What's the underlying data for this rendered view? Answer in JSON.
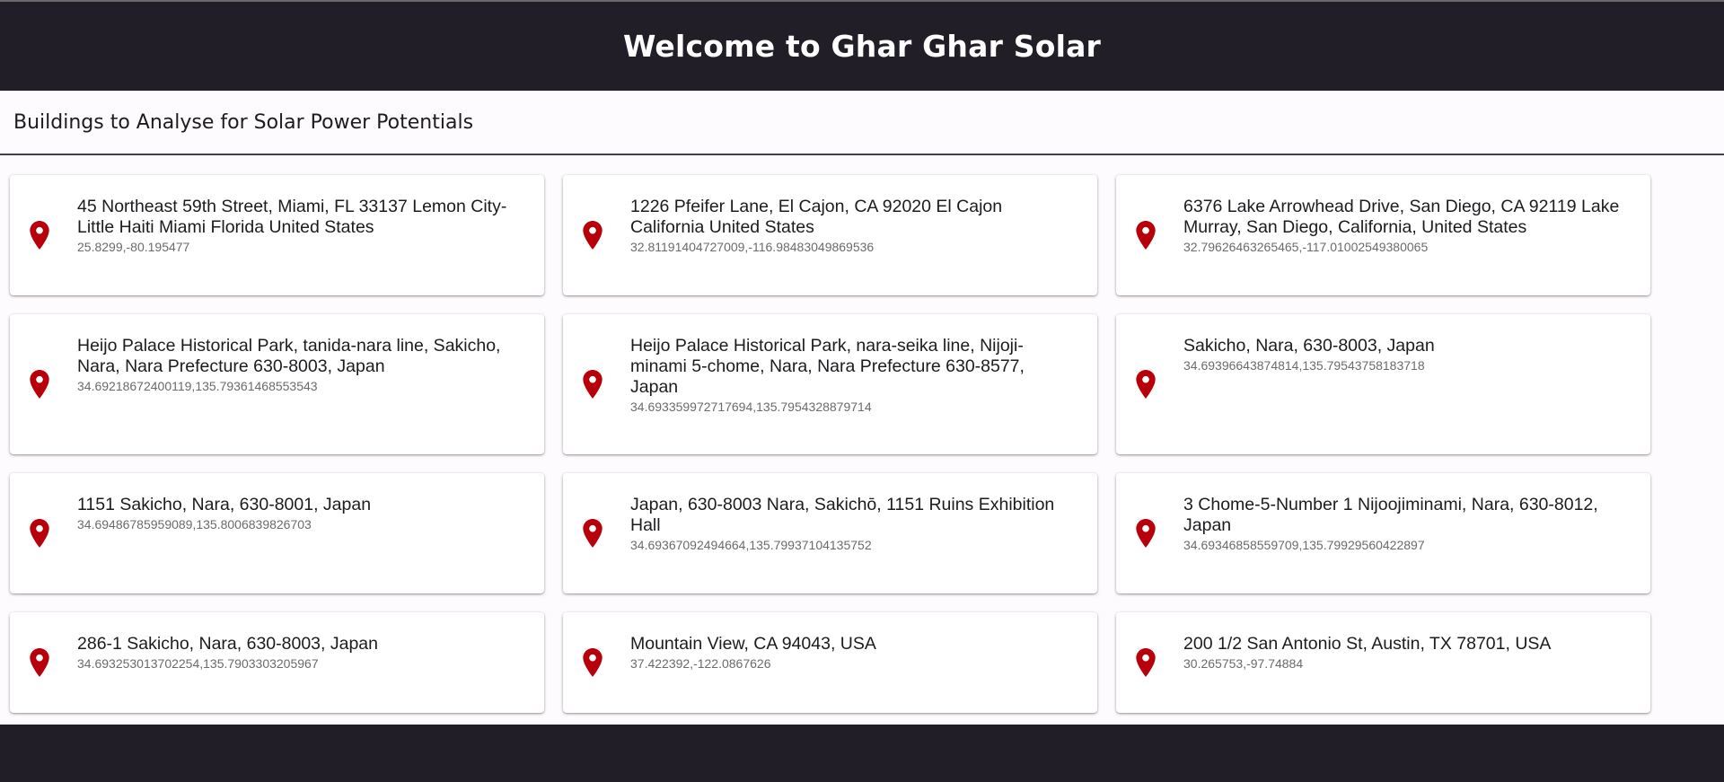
{
  "header": {
    "title": "Welcome to Ghar Ghar Solar"
  },
  "subheader": {
    "title": "Buildings to Analyse for Solar Power Potentials"
  },
  "colors": {
    "header_bg": "#221e27",
    "pin": "#b8000a",
    "page_bg": "#fefbfe"
  },
  "icons": {
    "location": "location-pin-icon"
  },
  "buildings": [
    {
      "address": "45 Northeast 59th Street, Miami, FL 33137 Lemon City-Little Haiti Miami Florida United States",
      "coords": "25.8299,-80.195477"
    },
    {
      "address": "1226 Pfeifer Lane, El Cajon, CA 92020 El Cajon California United States",
      "coords": "32.81191404727009,-116.98483049869536"
    },
    {
      "address": "6376 Lake Arrowhead Drive, San Diego, CA 92119 Lake Murray, San Diego, California, United States",
      "coords": "32.79626463265465,-117.01002549380065"
    },
    {
      "address": "Heijo Palace Historical Park, tanida-nara line, Sakicho, Nara, Nara Prefecture 630-8003, Japan",
      "coords": "34.69218672400119,135.79361468553543"
    },
    {
      "address": "Heijo Palace Historical Park, nara-seika line, Nijoji-minami 5-chome, Nara, Nara Prefecture 630-8577, Japan",
      "coords": "34.693359972717694,135.7954328879714"
    },
    {
      "address": "Sakicho, Nara, 630-8003, Japan",
      "coords": "34.69396643874814,135.79543758183718"
    },
    {
      "address": "1151 Sakicho, Nara, 630-8001, Japan",
      "coords": "34.69486785959089,135.8006839826703"
    },
    {
      "address": "Japan, 630-8003 Nara, Sakichō, 1151 Ruins Exhibition Hall",
      "coords": "34.69367092494664,135.79937104135752"
    },
    {
      "address": "3 Chome-5-Number 1 Nijoojiminami, Nara, 630-8012, Japan",
      "coords": "34.69346858559709,135.79929560422897"
    },
    {
      "address": "286-1 Sakicho, Nara, 630-8003, Japan",
      "coords": "34.693253013702254,135.7903303205967"
    },
    {
      "address": "Mountain View, CA 94043, USA",
      "coords": "37.422392,-122.0867626"
    },
    {
      "address": "200 1/2 San Antonio St, Austin, TX 78701, USA",
      "coords": "30.265753,-97.74884"
    }
  ]
}
